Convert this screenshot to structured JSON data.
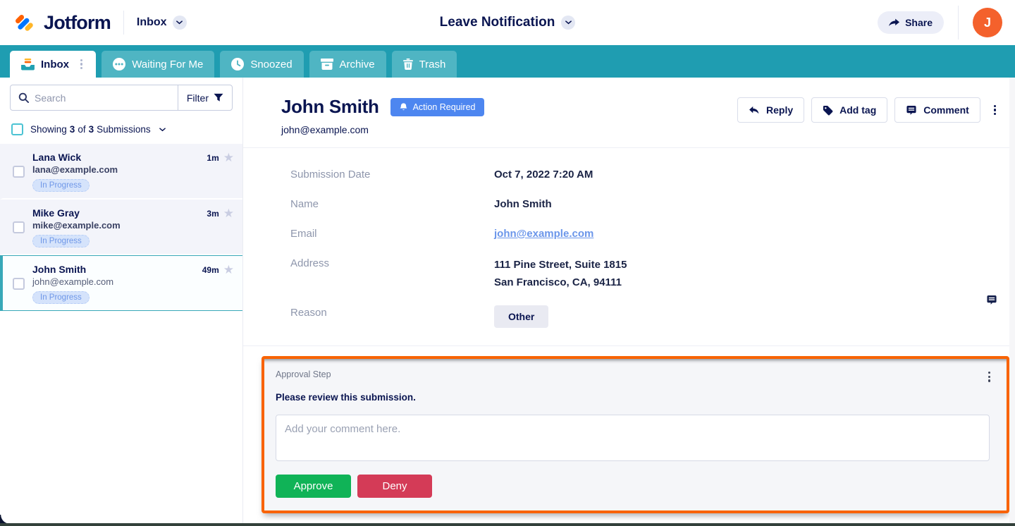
{
  "header": {
    "brand": "Jotform",
    "workspace_label": "Inbox",
    "form_title": "Leave Notification",
    "share_label": "Share",
    "avatar_initial": "J"
  },
  "tabs": {
    "inbox": "Inbox",
    "waiting": "Waiting For Me",
    "snoozed": "Snoozed",
    "archive": "Archive",
    "trash": "Trash"
  },
  "sidebar": {
    "search_placeholder": "Search",
    "filter_label": "Filter",
    "showing": {
      "prefix": "Showing",
      "count": "3",
      "of": "of",
      "total": "3",
      "suffix": "Submissions"
    },
    "items": [
      {
        "name": "Lana Wick",
        "email": "lana@example.com",
        "status": "In Progress",
        "time": "1m"
      },
      {
        "name": "Mike Gray",
        "email": "mike@example.com",
        "status": "In Progress",
        "time": "3m"
      },
      {
        "name": "John Smith",
        "email": "john@example.com",
        "status": "In Progress",
        "time": "49m"
      }
    ]
  },
  "main": {
    "title": "John Smith",
    "badge_label": "Action Required",
    "email": "john@example.com",
    "reply_label": "Reply",
    "add_tag_label": "Add tag",
    "comment_label": "Comment",
    "fields": [
      {
        "label": "Submission Date",
        "value": "Oct 7, 2022 7:20 AM"
      },
      {
        "label": "Name",
        "value": "John Smith"
      },
      {
        "label": "Email",
        "value": "john@example.com"
      },
      {
        "label": "Address",
        "line1": "111 Pine Street, Suite 1815",
        "line2": "San Francisco, CA, 94111"
      },
      {
        "label": "Reason",
        "value": "Other"
      }
    ]
  },
  "approval": {
    "step_label": "Approval Step",
    "message": "Please review this submission.",
    "comment_placeholder": "Add your comment here.",
    "approve_label": "Approve",
    "deny_label": "Deny"
  },
  "icons": {
    "star_glyph": "★"
  },
  "colors": {
    "brand_navy": "#0a1551",
    "tab_bar_teal": "#1f9db1",
    "tab_teal": "#4fb5c3",
    "orange_accent": "#f96302",
    "badge_blue": "#4d86f0",
    "status_badge_bg": "#d5e3fb",
    "status_badge_text": "#6f97e8",
    "approve_green": "#10b357",
    "deny_red": "#d43b57",
    "link_blue": "#6b96ea",
    "avatar_orange": "#f4612c",
    "selected_teal": "#38a8b8"
  }
}
